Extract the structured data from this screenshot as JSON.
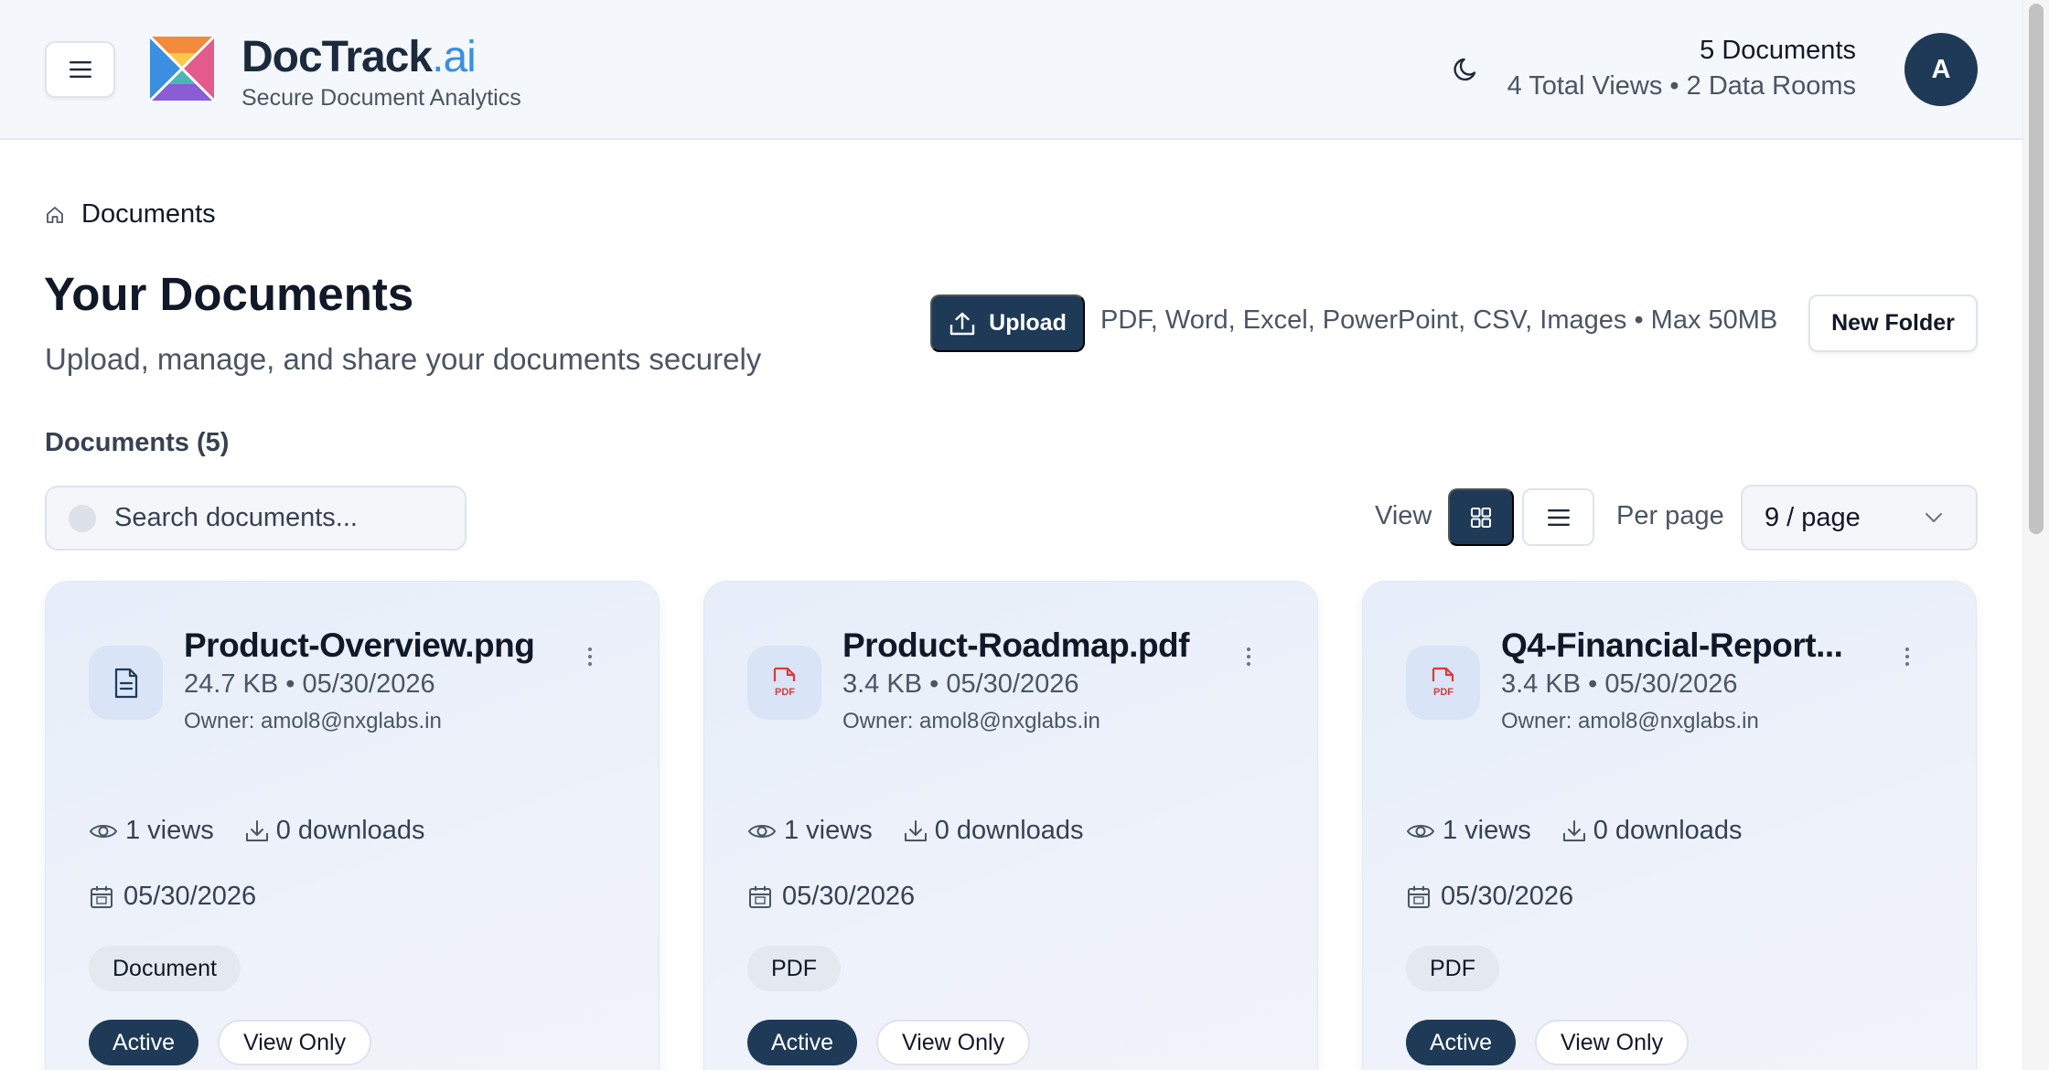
{
  "header": {
    "brand_main": "DocTrack",
    "brand_suffix": ".ai",
    "tagline": "Secure Document Analytics",
    "stats_docs": "5 Documents",
    "stats_sub": "4 Total Views • 2 Data Rooms",
    "avatar_initial": "A"
  },
  "breadcrumb": {
    "label": "Documents"
  },
  "page": {
    "title": "Your Documents",
    "subtitle": "Upload, manage, and share your documents securely"
  },
  "toolbar": {
    "upload_label": "Upload",
    "upload_hint": "PDF, Word, Excel, PowerPoint, CSV, Images • Max 50MB",
    "new_folder_label": "New Folder",
    "documents_count": "Documents (5)",
    "search_placeholder": "Search documents...",
    "view_label": "View",
    "per_page_label": "Per page",
    "per_page_value": "9 / page"
  },
  "cards": [
    {
      "title": "Product-Overview.png",
      "meta": "24.7 KB • 05/30/2026",
      "owner": "Owner: amol8@nxglabs.in",
      "views": "1 views",
      "downloads": "0 downloads",
      "date": "05/30/2026",
      "type": "Document",
      "status": "Active",
      "permission": "View Only",
      "icon": "document-icon"
    },
    {
      "title": "Product-Roadmap.pdf",
      "meta": "3.4 KB • 05/30/2026",
      "owner": "Owner: amol8@nxglabs.in",
      "views": "1 views",
      "downloads": "0 downloads",
      "date": "05/30/2026",
      "type": "PDF",
      "status": "Active",
      "permission": "View Only",
      "icon": "pdf-icon"
    },
    {
      "title": "Q4-Financial-Report...",
      "meta": "3.4 KB • 05/30/2026",
      "owner": "Owner: amol8@nxglabs.in",
      "views": "1 views",
      "downloads": "0 downloads",
      "date": "05/30/2026",
      "type": "PDF",
      "status": "Active",
      "permission": "View Only",
      "icon": "pdf-icon"
    }
  ],
  "icons": {
    "pdf_label": "PDF"
  },
  "colors": {
    "primary": "#1e3a57",
    "accent": "#3b8fe0",
    "pdf_red": "#d93a3a"
  }
}
